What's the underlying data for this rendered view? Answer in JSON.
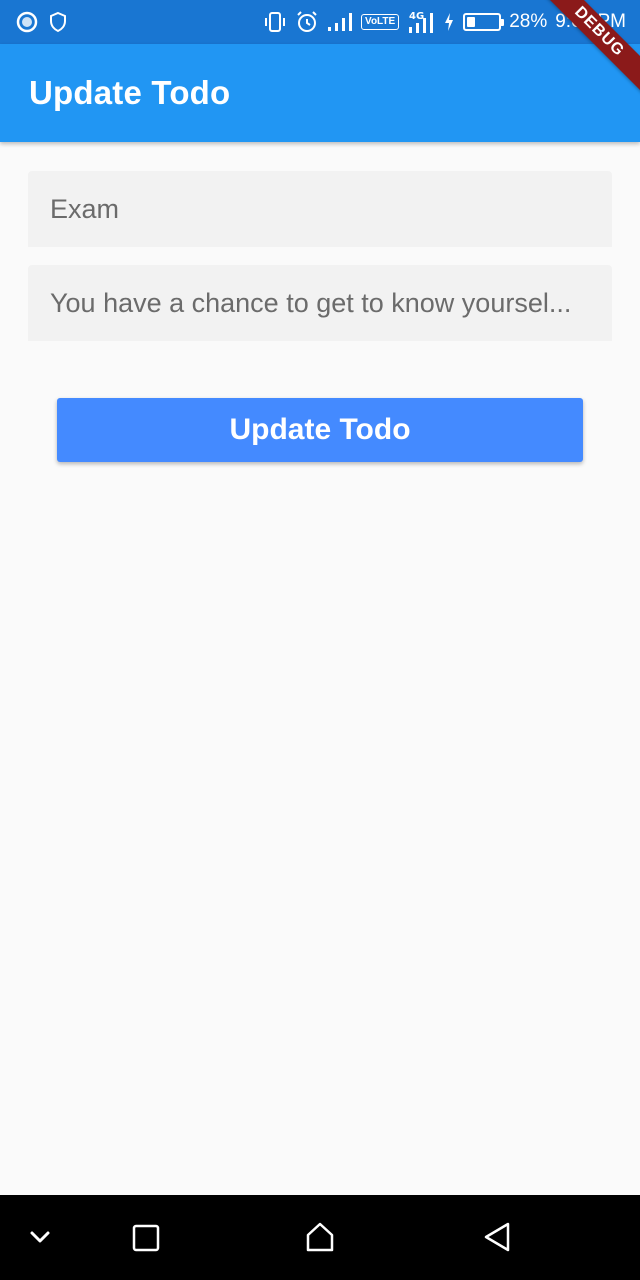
{
  "status_bar": {
    "battery_percent_text": "28%",
    "battery_level": 0.28,
    "time": "9:03 PM",
    "volte_label": "VoLTE",
    "network_label": "4G",
    "icons": [
      "record-icon",
      "shield-icon",
      "vibrate-icon",
      "alarm-icon",
      "signal-icon",
      "volte-icon",
      "4g-signal-icon",
      "charging-icon",
      "battery-icon"
    ]
  },
  "debug_banner": {
    "label": "DEBUG"
  },
  "app_bar": {
    "title": "Update Todo"
  },
  "form": {
    "title_field": {
      "value": "Exam"
    },
    "description_field": {
      "value": "You have a chance to get to know yoursel..."
    },
    "submit_label": "Update Todo"
  },
  "nav_bar": {
    "icons": [
      "chevron-down-icon",
      "recents-icon",
      "home-icon",
      "back-icon"
    ]
  },
  "colors": {
    "status_bar": "#1976d2",
    "app_bar": "#2196f3",
    "button": "#448aff",
    "background": "#fafafa",
    "field_fill": "#f2f2f2",
    "debug_ribbon": "#8b1a1a"
  }
}
